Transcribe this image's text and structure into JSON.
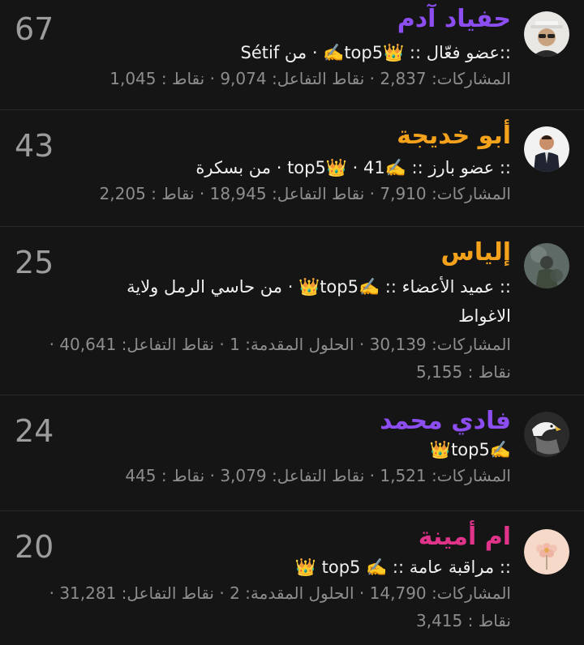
{
  "colors": {
    "purple": "#8c4ef0",
    "orange": "#f4a21c",
    "pink": "#e0338a",
    "background": "#151516",
    "muted": "#8d8d8d"
  },
  "members": [
    {
      "name": "حفياد آدم",
      "name_color": "purple",
      "count": "67",
      "title": "::عضو فعّال :: 👑top5✍️ · من Sétif",
      "stats": "المشاركات: 2,837 · نقاط التفاعل: 9,074 · نقاط : 1,045",
      "avatar_icon": "avatar-hat-glasses-icon"
    },
    {
      "name": "أبو خديجة",
      "name_color": "orange",
      "count": "43",
      "title": ":: عضو بارز :: ✍️top5👑 · 41 · من بسكرة",
      "stats": "المشاركات: 7,910 · نقاط التفاعل: 18,945 · نقاط : 2,205",
      "avatar_icon": "avatar-suit-man-icon"
    },
    {
      "name": "إلياس",
      "name_color": "orange",
      "count": "25",
      "title": ":: عميد الأعضاء :: ✍️top5👑 · من حاسي الرمل ولاية الاغواط",
      "stats": "المشاركات: 30,139 · الحلول المقدمة: 1 · نقاط التفاعل: 40,641 · نقاط : 5,155",
      "avatar_icon": "avatar-soldier-icon"
    },
    {
      "name": "فادي محمد",
      "name_color": "purple",
      "count": "24",
      "title": "✍️top5👑",
      "stats": "المشاركات: 1,521 · نقاط التفاعل: 3,079 · نقاط : 445",
      "avatar_icon": "avatar-eagle-icon"
    },
    {
      "name": "ام أمينة",
      "name_color": "pink",
      "count": "20",
      "title": ":: مراقبة عامة :: ✍️ top5 👑",
      "stats": "المشاركات: 14,790 · الحلول المقدمة: 2 · نقاط التفاعل: 31,281 · نقاط : 3,415",
      "avatar_icon": "avatar-flower-icon"
    }
  ]
}
